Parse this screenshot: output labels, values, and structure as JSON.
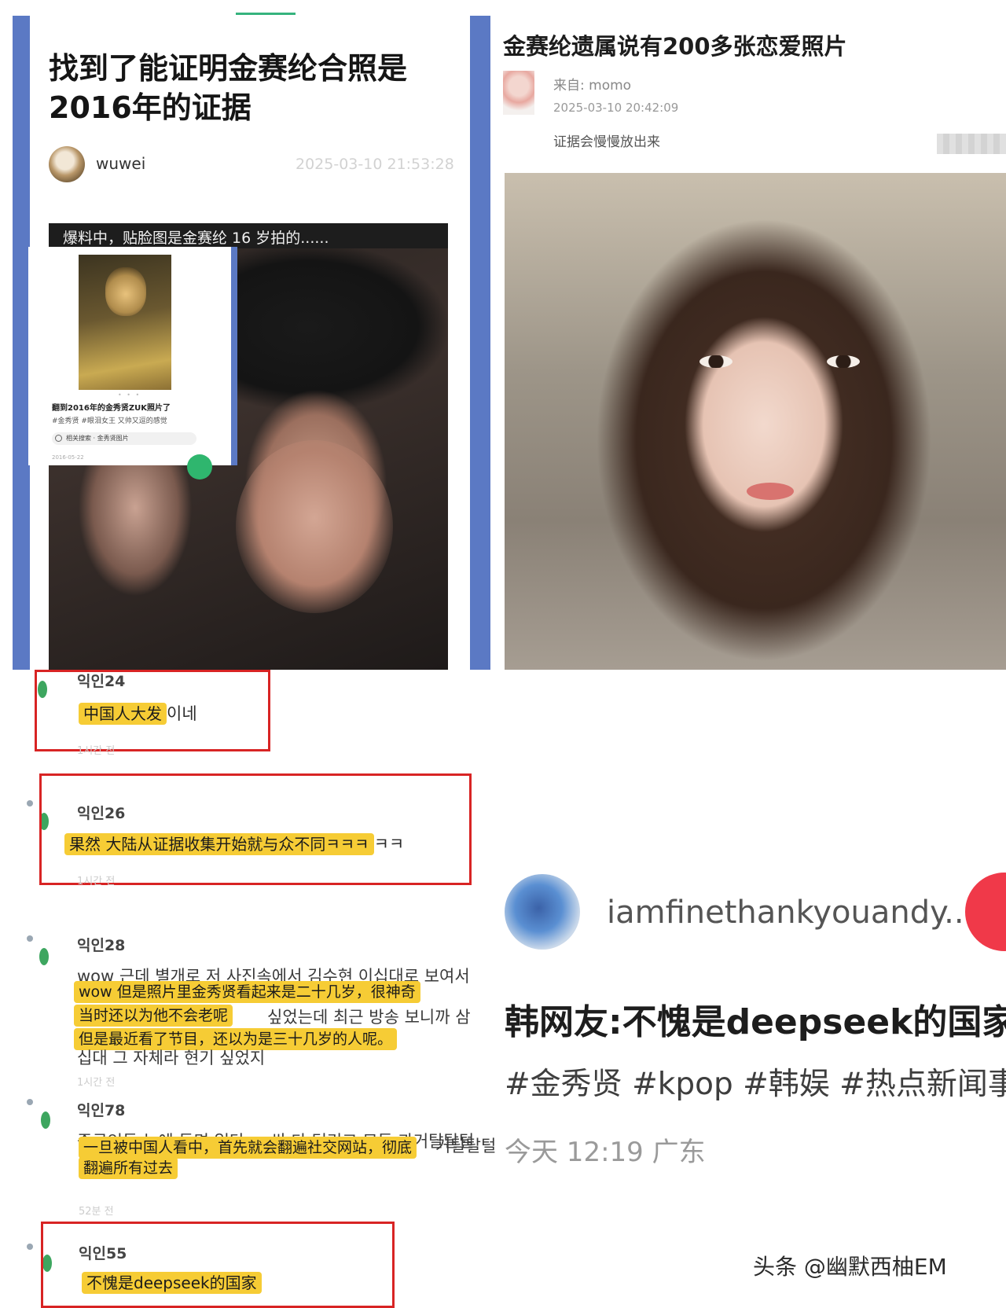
{
  "left_post": {
    "title": "找到了能证明金赛纶合照是2016年的证据",
    "author": "wuwei",
    "date": "2025-03-10 21:53:28",
    "leak_caption": "爆料中，贴脸图是金赛纶 16 岁拍的......",
    "inset": {
      "title": "翻到2016年的金秀贤ZUK照片了",
      "tags": "#金秀贤  #眼泪女王  又帅又逗的感觉",
      "search": "相关搜索 · 金秀贤图片",
      "date": "2016-05-22"
    }
  },
  "right_post": {
    "title": "金赛纶遗属说有200多张恋爱照片",
    "from": "来自: momo",
    "date": "2025-03-10 20:42:09",
    "text": "证据会慢慢放出来"
  },
  "comments": [
    {
      "author": "익인24",
      "highlight": "中国人大发",
      "korean": "이네",
      "time": "1시간 전"
    },
    {
      "author": "익인26",
      "highlight": "果然 大陆从证据收集开始就与众不同ㅋㅋㅋ",
      "korean": "ㅋㅋ",
      "time": "1시간 전"
    },
    {
      "author": "익인28",
      "korean_top": "wow 근데 별개로 저 사진속에서 김수현 이십대로 보여서",
      "highlight_lines": [
        "wow 但是照片里金秀贤看起来是二十几岁，很神奇",
        "当时还以为他不会老呢",
        "但是最近看了节目，还以为是三十几岁的人呢。"
      ],
      "korean_mid": "싶었는데 최근 방송 보니까 삼",
      "korean_bottom": "십대 그 자체라 현기 싶었지",
      "time": "1시간 전"
    },
    {
      "author": "익인78",
      "korean_top": "중국인들 눈에 들면 일단 ... 싹 다 털리고 모든 과거탈탈털",
      "highlight_lines": [
        "一旦被中国人看中，首先就会翻遍社交网站，彻底",
        "翻遍所有过去"
      ],
      "korean_tail": "거탈탈털",
      "time": "52분 전"
    },
    {
      "author": "익인55",
      "highlight": "不愧是deepseek的国家"
    }
  ],
  "card": {
    "username": "iamfinethankyouandy...",
    "title": "韩网友:不愧是deepseek的国家",
    "tags": "#金秀贤 #kpop #韩娱 #热点新闻事",
    "time_location": "今天 12:19 广东"
  },
  "watermark": "头条 @幽默西柚EM"
}
